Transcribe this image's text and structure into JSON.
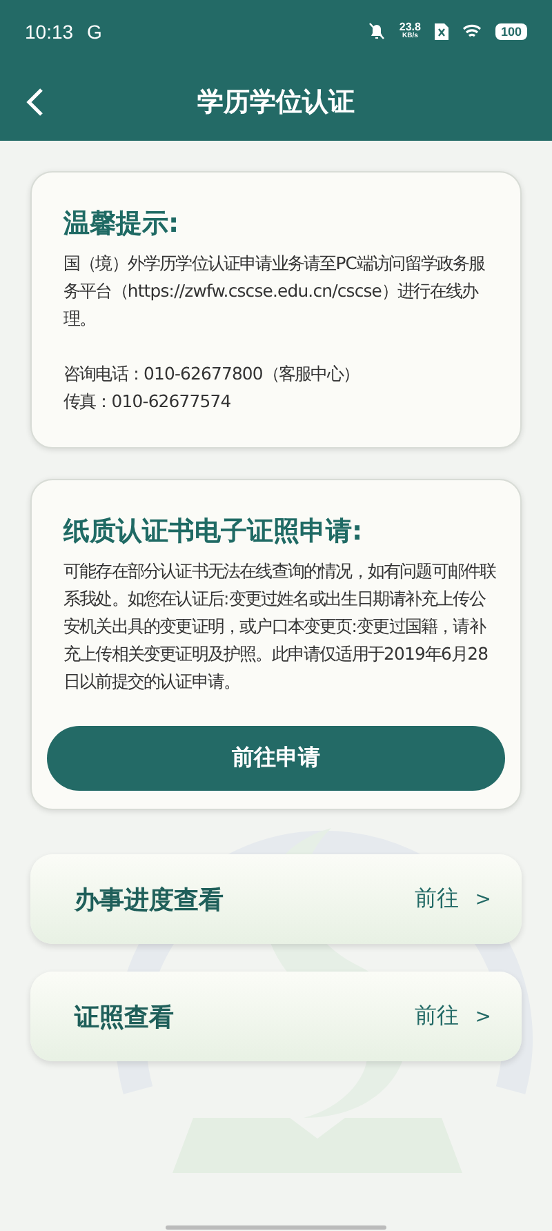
{
  "status_bar": {
    "time": "10:13",
    "carrier": "G",
    "speed": "23.8",
    "speed_unit": "KB/s",
    "battery": "100"
  },
  "header": {
    "title": "学历学位认证"
  },
  "notice": {
    "title": "温馨提示:",
    "body": "国（境）外学历学位认证申请业务请至PC端访问留学政务服务平台（https://zwfw.cscse.edu.cn/cscse）进行在线办理。",
    "contacts": [
      "咨询电话：010-62677800（客服中心）",
      "传真：010-62677574"
    ]
  },
  "paper_cert": {
    "title": "纸质认证书电子证照申请:",
    "body": "可能存在部分认证书无法在线查询的情况，如有问题可邮件联系我处。如您在认证后:变更过姓名或出生日期请补充上传公安机关出具的变更证明，或户口本变更页:变更过国籍，请补充上传相关变更证明及护照。此申请仅适用于2019年6月28日以前提交的认证申请。",
    "button": "前往申请"
  },
  "links": [
    {
      "label": "办事进度查看",
      "action": "前往",
      "arrow": ">"
    },
    {
      "label": "证照查看",
      "action": "前往",
      "arrow": ">"
    }
  ]
}
